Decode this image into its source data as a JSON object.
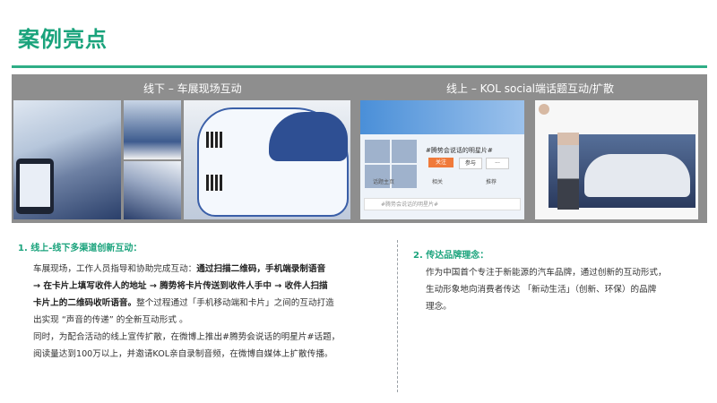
{
  "title": "案例亮点",
  "captions": {
    "left": "线下 – 车展现场互动",
    "right": "线上 – KOL social端话题互动/扩散"
  },
  "screens": {
    "weibo_page_title": "#腾势会说话的明星片#",
    "btn_follow": "关注",
    "btn_join": "参与",
    "btn_more": "···",
    "tabs": [
      "话题主页",
      "相关",
      "推荐"
    ],
    "input_placeholder": "#腾势会说话的明星片# "
  },
  "section1": {
    "heading": "1. 线上-线下多渠道创新互动：",
    "lines": [
      {
        "plain": "车展现场，工作人员指导和协助完成互动：",
        "bold": "通过扫描二维码，手机端录制语音"
      },
      {
        "bold": "→ 在卡片上填写收件人的地址 → 腾势将卡片传送到收件人手中 → 收件人扫描"
      },
      {
        "bold": "卡片上的二维码收听语音。",
        "plain": "整个过程通过「手机移动端和卡片」之间的互动打造"
      },
      {
        "plain": "出实现 “声音的传递” 的全新互动形式 。"
      },
      {
        "plain": "同时，为配合活动的线上宣传扩散，在微博上推出#腾势会说话的明星片#话题，"
      },
      {
        "plain": "阅读量达到100万以上，并邀请KOL亲自录制音频，在微博自媒体上扩散传播。"
      }
    ]
  },
  "section2": {
    "heading": "2. 传达品牌理念：",
    "lines": [
      "作为中国首个专注于新能源的汽车品牌，通过创新的互动形式，",
      "生动形象地向消费者传达 「新动生活」（创新、环保）的品牌",
      "理念。"
    ]
  },
  "colors": {
    "accent": "#1aa37c",
    "rule": "#2fae86",
    "panel": "#8e8e8e"
  }
}
